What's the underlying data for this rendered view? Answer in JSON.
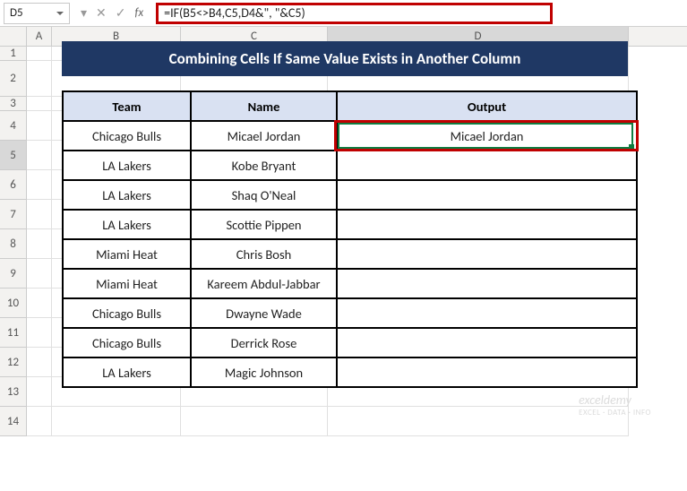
{
  "cell_ref": "D5",
  "formula": "=IF(B5<>B4,C5,D4&\", \"&C5)",
  "fx_label": "fx",
  "fx_cancel": "✕",
  "fx_ok": "✓",
  "fx_dd": "▾",
  "columns": {
    "A": "A",
    "B": "B",
    "C": "C",
    "D": "D"
  },
  "title": "Combining Cells If Same Value Exists in Another Column",
  "headers": {
    "team": "Team",
    "name": "Name",
    "output": "Output"
  },
  "rows": [
    {
      "team": "Chicago Bulls",
      "name": "Micael Jordan",
      "output": "Micael Jordan"
    },
    {
      "team": "LA Lakers",
      "name": "Kobe Bryant",
      "output": ""
    },
    {
      "team": "LA Lakers",
      "name": "Shaq O'Neal",
      "output": ""
    },
    {
      "team": "LA Lakers",
      "name": "Scottie Pippen",
      "output": ""
    },
    {
      "team": "Miami Heat",
      "name": "Chris Bosh",
      "output": ""
    },
    {
      "team": "Miami Heat",
      "name": "Kareem Abdul-Jabbar",
      "output": ""
    },
    {
      "team": "Chicago Bulls",
      "name": "Dwayne Wade",
      "output": ""
    },
    {
      "team": "Chicago Bulls",
      "name": "Derrick Rose",
      "output": ""
    },
    {
      "team": "LA Lakers",
      "name": "Magic Johnson",
      "output": ""
    }
  ],
  "row_numbers": [
    "1",
    "2",
    "3",
    "4",
    "5",
    "6",
    "7",
    "8",
    "9",
    "10",
    "11",
    "12",
    "13",
    "14"
  ],
  "watermark": {
    "main": "exceldemy",
    "sub": "EXCEL · DATA · INFO"
  }
}
